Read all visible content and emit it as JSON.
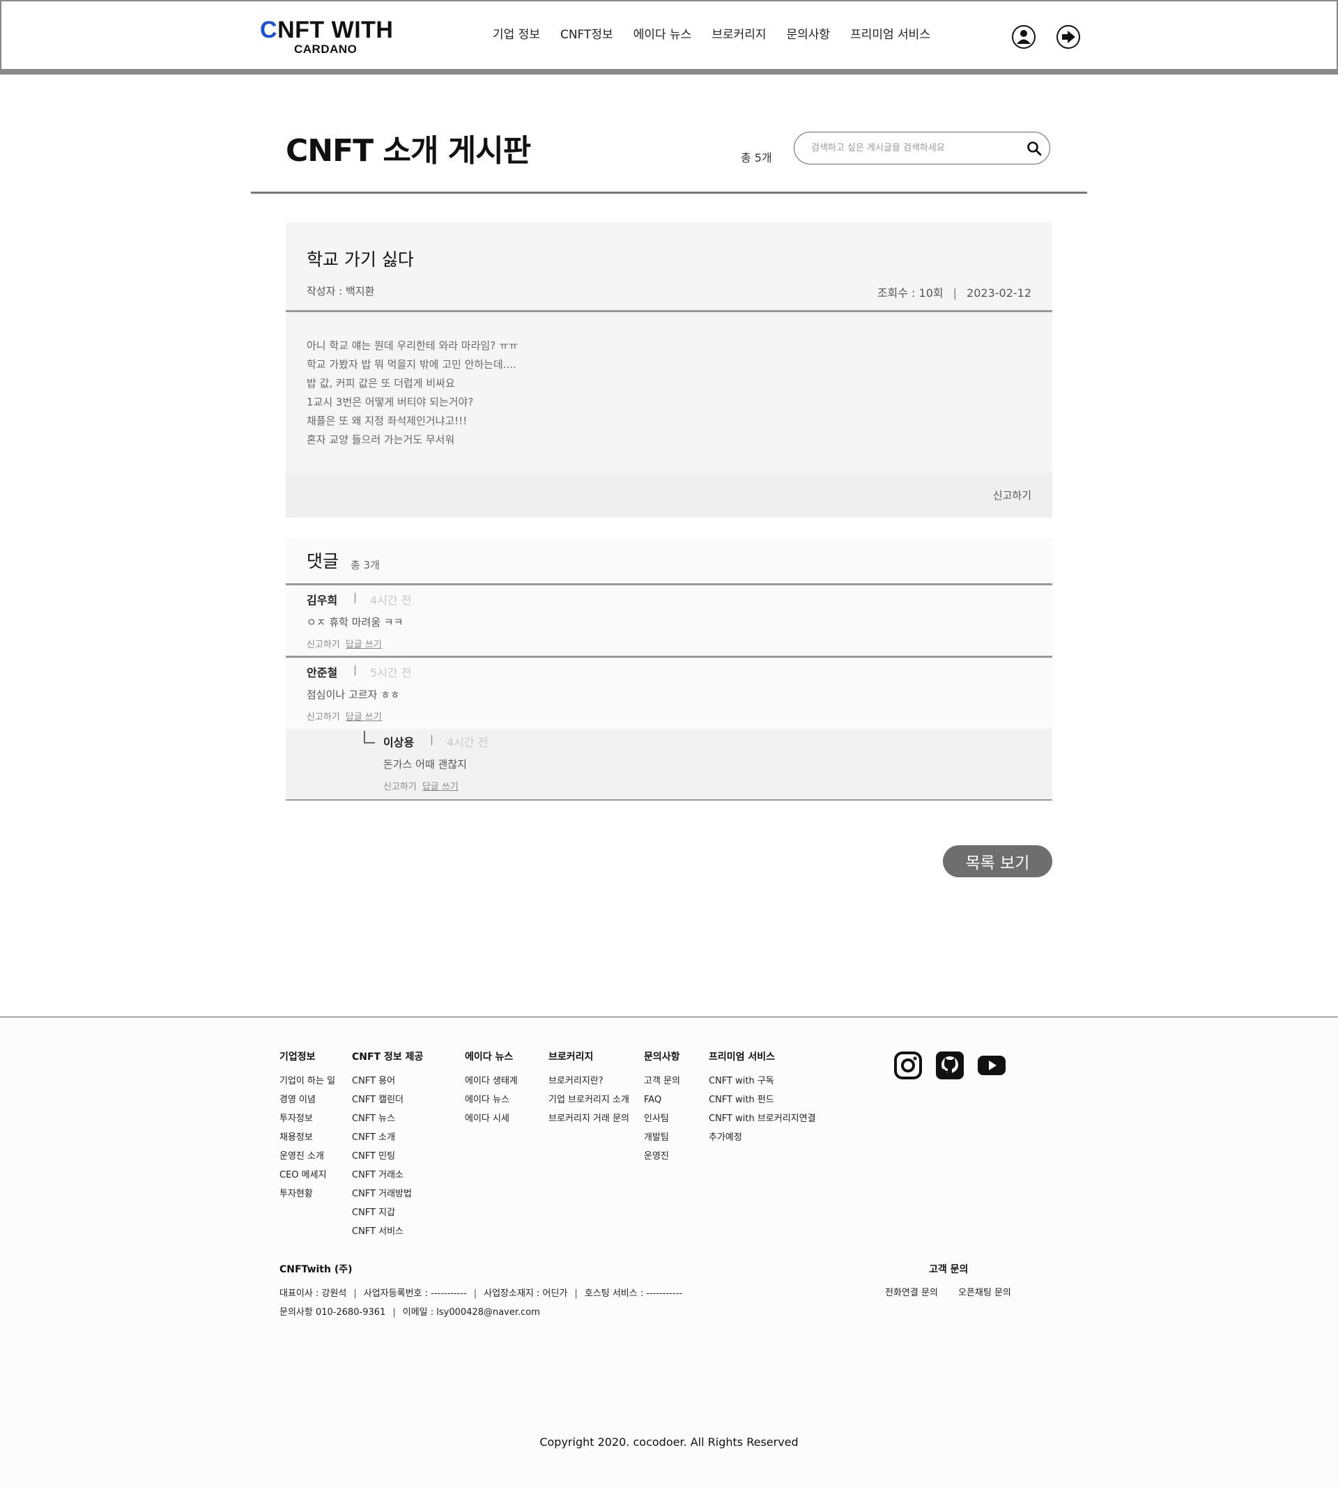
{
  "header": {
    "logo_main_c": "C",
    "logo_main_rest": "NFT WITH",
    "logo_sub": "CARDANO",
    "nav": [
      "기업 정보",
      "CNFT정보",
      "에이다 뉴스",
      "브로커리지",
      "문의사항",
      "프리미엄 서비스"
    ],
    "icons": [
      "user-icon",
      "logout-icon"
    ]
  },
  "board": {
    "title": "CNFT 소개 게시판",
    "count": "총 5개",
    "search_placeholder": "검색하고 싶은 게시글을 검색하세요"
  },
  "post": {
    "title": "학교 가기 싫다",
    "author": "작성자 : 백지환",
    "views": "조회수 : 10회",
    "separator": "|",
    "date": "2023-02-12",
    "body": [
      "아니 학교 얘는 뭔데 우리한테 와라 마라임? ㅠㅠ",
      "학교 가봤자 밥 뭐 먹을지 밖에 고민 안하는데....",
      "밥 값, 커피 값은 또 더럽게 비싸요",
      "1교시 3번은 어떻게 버티야 되는거야?",
      "채플은 또 왜 지정 좌석제인거냐고!!!",
      "혼자 교양 들으러 가는거도 무서워"
    ],
    "report": "신고하기"
  },
  "comments": {
    "title": "댓글",
    "count": "총 3개",
    "items": [
      {
        "name": "김우희",
        "sep": "|",
        "time": "4시간 전",
        "text": "ㅇㅈ 휴학 마려움 ㅋㅋ",
        "report": "신고하기",
        "reply": "답글 쓰기"
      },
      {
        "name": "안준철",
        "sep": "|",
        "time": "5시간 전",
        "text": "점심이나 고르자 ㅎㅎ",
        "report": "신고하기",
        "reply": "답글 쓰기"
      }
    ],
    "reply": {
      "name": "이상용",
      "sep": "|",
      "time": "4시간 전",
      "text": "돈가스 어때 괜찮지",
      "report": "신고하기",
      "reply": "답글 쓰기"
    }
  },
  "list_button": "목록 보기",
  "footer": {
    "columns": [
      {
        "title": "기업정보",
        "items": [
          "기업이 하는 일",
          "경영 이념",
          "투자정보",
          "채용정보",
          "운영진 소개",
          "CEO 메세지",
          "투자현황"
        ]
      },
      {
        "title": "CNFT 정보 제공",
        "items": [
          "CNFT 용어",
          "CNFT 캘린더",
          "CNFT 뉴스",
          "CNFT 소개",
          "CNFT 민팅",
          "CNFT 거래소",
          "CNFT 거래방법",
          "CNFT 지갑",
          "CNFT 서비스"
        ]
      },
      {
        "title": "에이다 뉴스",
        "items": [
          "에이다 생태계",
          "에이다 뉴스",
          "에이다 시세"
        ]
      },
      {
        "title": "브로커리지",
        "items": [
          "브로커리지란?",
          "기업 브로커리지 소개",
          "브로커리지 거래 문의"
        ]
      },
      {
        "title": "문의사항",
        "items": [
          "고객 문의",
          "FAQ",
          "인사팀",
          "개발팀",
          "운영진"
        ]
      },
      {
        "title": "프리미엄 서비스",
        "items": [
          "CNFT with 구독",
          "CNFT with 펀드",
          "CNFT with 브로커리지연결",
          "추가예정"
        ]
      }
    ],
    "social": [
      "instagram-icon",
      "github-icon",
      "youtube-icon"
    ],
    "company": "CNFTwith (주)",
    "ceo": "대표이사 : 강원석",
    "biz_no": "사업자등록번호 : -----------",
    "address": "사업장소재지 : 어딘가",
    "hosting": "호스팅 서비스 : -----------",
    "sep": "|",
    "phone": "문의사항  010-2680-9361",
    "email": "이메일 : lsy000428@naver.com",
    "cs_title": "고객 문의",
    "cs_links": [
      "전화연결 문의",
      "오픈채팅 문의"
    ],
    "copyright": "Copyright 2020. cocodoer. All Rights Reserved"
  },
  "colors": {
    "logo_accent": "#1b4fd8",
    "header_bar": "#888888",
    "post_bg": "#f5f5f5",
    "button_bg": "#6e6e6e"
  }
}
